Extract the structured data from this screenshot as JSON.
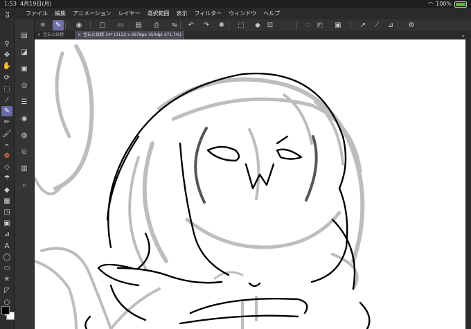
{
  "status": {
    "time": "1:53",
    "date": "4月19日(月)",
    "battery": "100%",
    "battery_level": 1.0
  },
  "menu": [
    "ファイル",
    "編集",
    "アニメーション",
    "レイヤー",
    "選択範囲",
    "表示",
    "フィルター",
    "ウィンドウ",
    "ヘルプ"
  ],
  "tabs": [
    {
      "label": "宝石と妖精"
    },
    {
      "label": "宝石と妖精 34* (2122 x 2976px 350dpi 471.7%)"
    }
  ],
  "toolbar_icons": [
    "menu-icon",
    "brush-tool-icon",
    "view-icon",
    "new-icon",
    "open-icon",
    "save-icon",
    "print-icon",
    "flip-icon",
    "undo-icon",
    "redo-icon",
    "clear-icon",
    "transform-icon",
    "fill-icon",
    "crop-icon",
    "lasso-icon",
    "stamp-icon",
    "frame-icon",
    "correct-line-icon",
    "rule-icon",
    "ruler-icon",
    "settings-icon"
  ],
  "left_tools": [
    "magnify-icon",
    "move-icon",
    "hand-icon",
    "rotate-icon",
    "selection-icon",
    "eyedropper-icon",
    "pen-icon",
    "pencil-icon",
    "brush-icon",
    "airbrush-icon",
    "decoration-icon",
    "eraser-icon",
    "blend-icon",
    "fill-icon",
    "gradient-icon",
    "shape-icon",
    "frame-icon",
    "ruler-icon",
    "text-icon",
    "balloon-icon",
    "lasso-icon",
    "star-icon",
    "triangle-icon",
    "circle-icon",
    "dot-icon"
  ],
  "sub_tools": [
    "layer-icon",
    "layer-properties-icon",
    "subview-icon",
    "navigator-icon",
    "tool-property-icon",
    "brush-size-icon",
    "color-wheel-icon",
    "history-icon",
    "material-icon",
    "search-icon"
  ],
  "colors": {
    "accent": "#6a6aa6",
    "canvas": "#ffffff",
    "sketch": "#bdbdbd",
    "ink": "#000000"
  }
}
